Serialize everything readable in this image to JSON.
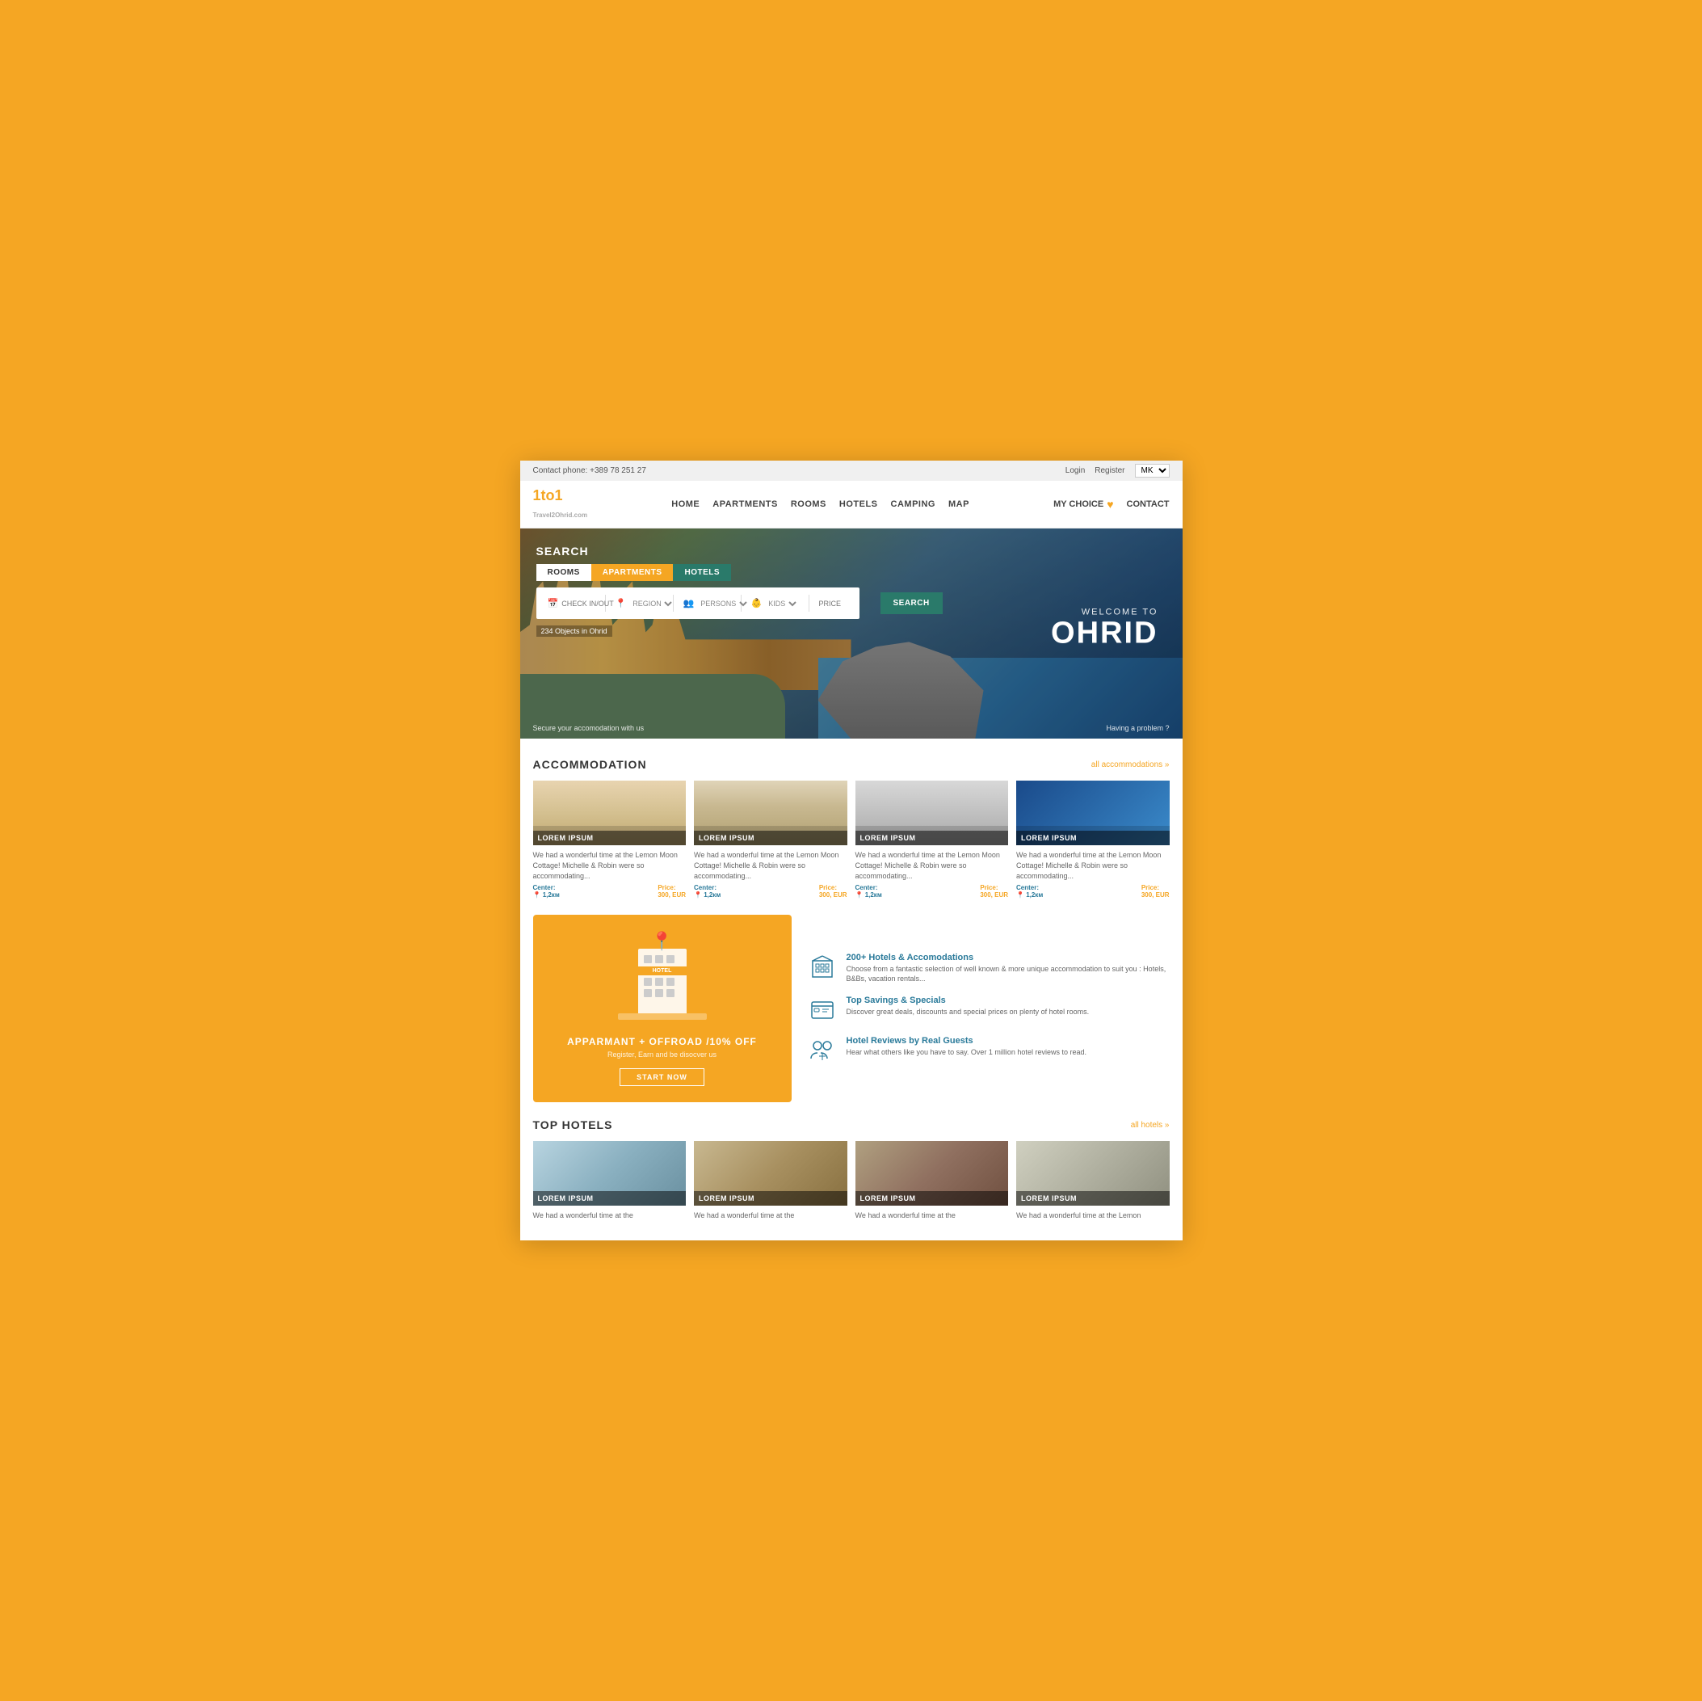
{
  "topbar": {
    "contact": "Contact phone: +389 78 251 27",
    "login": "Login",
    "register": "Register",
    "lang": "MK"
  },
  "navbar": {
    "logo": "1to1",
    "logo_sub": "Travel2Ohrid.com",
    "links": [
      "HOME",
      "APARTMENTS",
      "ROOMS",
      "HOTELS",
      "CAMPING",
      "MAP"
    ],
    "my_choice": "MY CHOICE",
    "contact": "CONTACT"
  },
  "hero": {
    "search_label": "SEARCH",
    "tab_rooms": "ROOMS",
    "tab_apartments": "APARTMENTS",
    "tab_hotels": "HOTELS",
    "field_checkin": "CHECK IN/OUT",
    "field_region": "REGION",
    "field_persons": "PERSONS",
    "field_kids": "KIDS",
    "field_price": "PRICE",
    "search_btn": "SEARCH",
    "objects_count": "234 Objects in Ohrid",
    "welcome_to": "WELCOME TO",
    "city_name": "OHRID",
    "bottom_left": "Secure your accomodation with us",
    "bottom_right": "Having a problem ?"
  },
  "accommodation": {
    "section_title": "ACCOMMODATION",
    "link_all": "all accommodations »",
    "cards": [
      {
        "label": "LOREM IPSUM",
        "desc": "We had a wonderful time at the Lemon Moon Cottage! Michelle & Robin were so accommodating...",
        "center_label": "Center:",
        "distance": "1,2км",
        "price_label": "Price:",
        "price": "300, EUR"
      },
      {
        "label": "LOREM IPSUM",
        "desc": "We had a wonderful time at the Lemon Moon Cottage! Michelle & Robin were so accommodating...",
        "center_label": "Center:",
        "distance": "1,2км",
        "price_label": "Price:",
        "price": "300, EUR"
      },
      {
        "label": "LOREM IPSUM",
        "desc": "We had a wonderful time at the Lemon Moon Cottage! Michelle & Robin were so accommodating...",
        "center_label": "Center:",
        "distance": "1,2км",
        "price_label": "Price:",
        "price": "300, EUR"
      },
      {
        "label": "LOREM IPSUM",
        "desc": "We had a wonderful time at the Lemon Moon Cottage! Michelle & Robin were so accommodating...",
        "center_label": "Center:",
        "distance": "1,2км",
        "price_label": "Price:",
        "price": "300, EUR"
      }
    ]
  },
  "promo": {
    "title": "APPARMANT + OFFROAD /10% OFF",
    "subtitle": "Register, Earn and be disocver us",
    "btn": "START NOW",
    "pin_icon": "📍"
  },
  "features": [
    {
      "icon": "🏢",
      "title": "200+ Hotels & Accomodations",
      "desc": "Choose from a fantastic selection of well known & more unique accommodation to suit you : Hotels, B&Bs, vacation rentals..."
    },
    {
      "icon": "🏷",
      "title": "Top Savings & Specials",
      "desc": "Discover great deals, discounts and special prices on plenty of hotel rooms."
    },
    {
      "icon": "👥",
      "title": "Hotel Reviews by Real Guests",
      "desc": "Hear what others like you have to say. Over 1 million hotel reviews to read."
    }
  ],
  "top_hotels": {
    "section_title": "TOP HOTELS",
    "link_all": "all hotels »",
    "cards": [
      {
        "label": "LOREM IPSUM",
        "desc": "We had a wonderful time at the"
      },
      {
        "label": "LOREM IPSUM",
        "desc": "We had a wonderful time at the"
      },
      {
        "label": "LOREM IPSUM",
        "desc": "We had a wonderful time at the"
      },
      {
        "label": "LOREM IPSUM",
        "desc": "We had a wonderful time at the Lemon"
      }
    ]
  }
}
